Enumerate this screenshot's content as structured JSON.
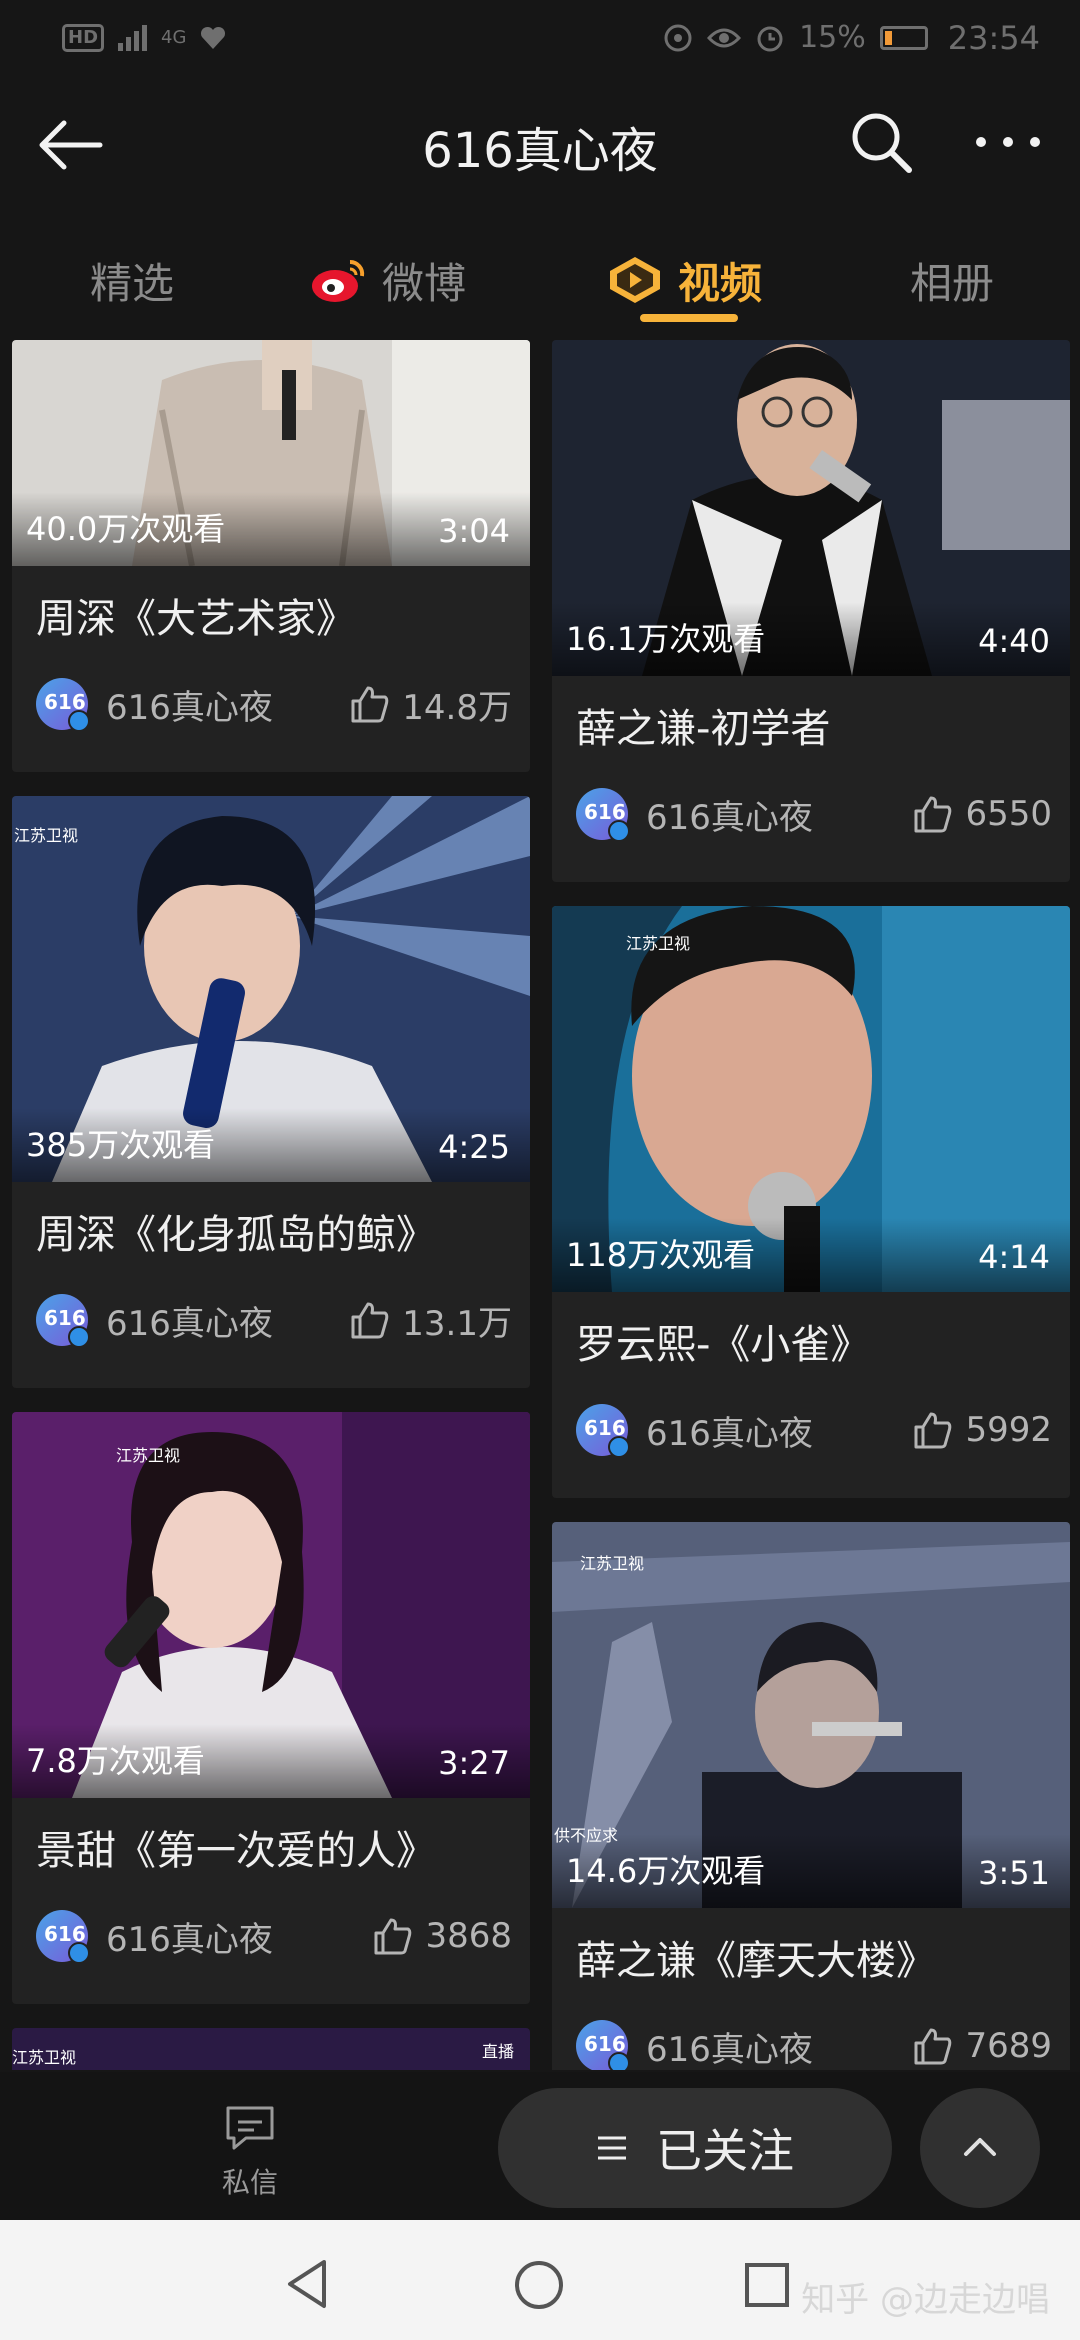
{
  "status": {
    "time": "23:54",
    "battery": "15%",
    "network": "4G",
    "hd": "HD"
  },
  "header": {
    "title": "616真心夜"
  },
  "tabs": [
    {
      "label": "精选"
    },
    {
      "label": "微博"
    },
    {
      "label": "视频"
    },
    {
      "label": "相册"
    }
  ],
  "cards": [
    {
      "views": "40.0万次观看",
      "duration": "3:04",
      "title": "周深《大艺术家》",
      "author": "616真心夜",
      "likes": "14.8万"
    },
    {
      "views": "16.1万次观看",
      "duration": "4:40",
      "title": "薛之谦-初学者",
      "author": "616真心夜",
      "likes": "6550"
    },
    {
      "views": "385万次观看",
      "duration": "4:25",
      "title": "周深《化身孤岛的鲸》",
      "author": "616真心夜",
      "likes": "13.1万"
    },
    {
      "views": "118万次观看",
      "duration": "4:14",
      "title": "罗云熙-《小雀》",
      "author": "616真心夜",
      "likes": "5992"
    },
    {
      "views": "7.8万次观看",
      "duration": "3:27",
      "title": "景甜《第一次爱的人》",
      "author": "616真心夜",
      "likes": "3868"
    },
    {
      "views": "14.6万次观看",
      "duration": "3:51",
      "title": "薛之谦《摩天大楼》",
      "author": "616真心夜",
      "likes": "7689"
    }
  ],
  "thumb_text": {
    "channel": "江苏卫视",
    "live": "直播",
    "extra": "供不应求"
  },
  "bottom": {
    "message": "私信",
    "follow": "已关注"
  },
  "watermark": "知乎 @边走边唱",
  "colors": {
    "accent": "#f7b33a",
    "background": "#161616",
    "card": "#222222"
  },
  "icons": {
    "back": "back-arrow-icon",
    "search": "search-icon",
    "more": "more-icon",
    "weibo": "weibo-icon",
    "video": "video-icon",
    "like": "thumb-up-icon"
  }
}
